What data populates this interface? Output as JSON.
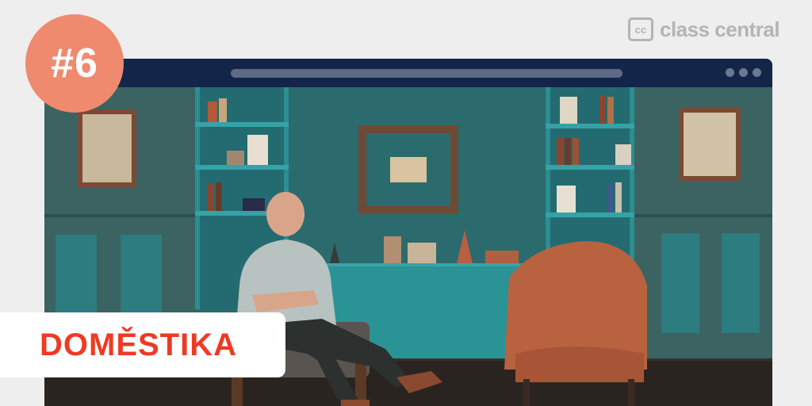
{
  "badge": {
    "text": "#6"
  },
  "brand": {
    "mark": "cc",
    "name": "class central"
  },
  "domestika": {
    "text": "DOMĚSTIKA"
  },
  "colors": {
    "badge": "#f08a6e",
    "browser_bar": "#14254a",
    "domestika": "#ee3a24",
    "background": "#eeeeee",
    "teal_wall": "#2b6a6d"
  },
  "icons": [
    "class-central-logo-icon",
    "window-dots-icon"
  ]
}
